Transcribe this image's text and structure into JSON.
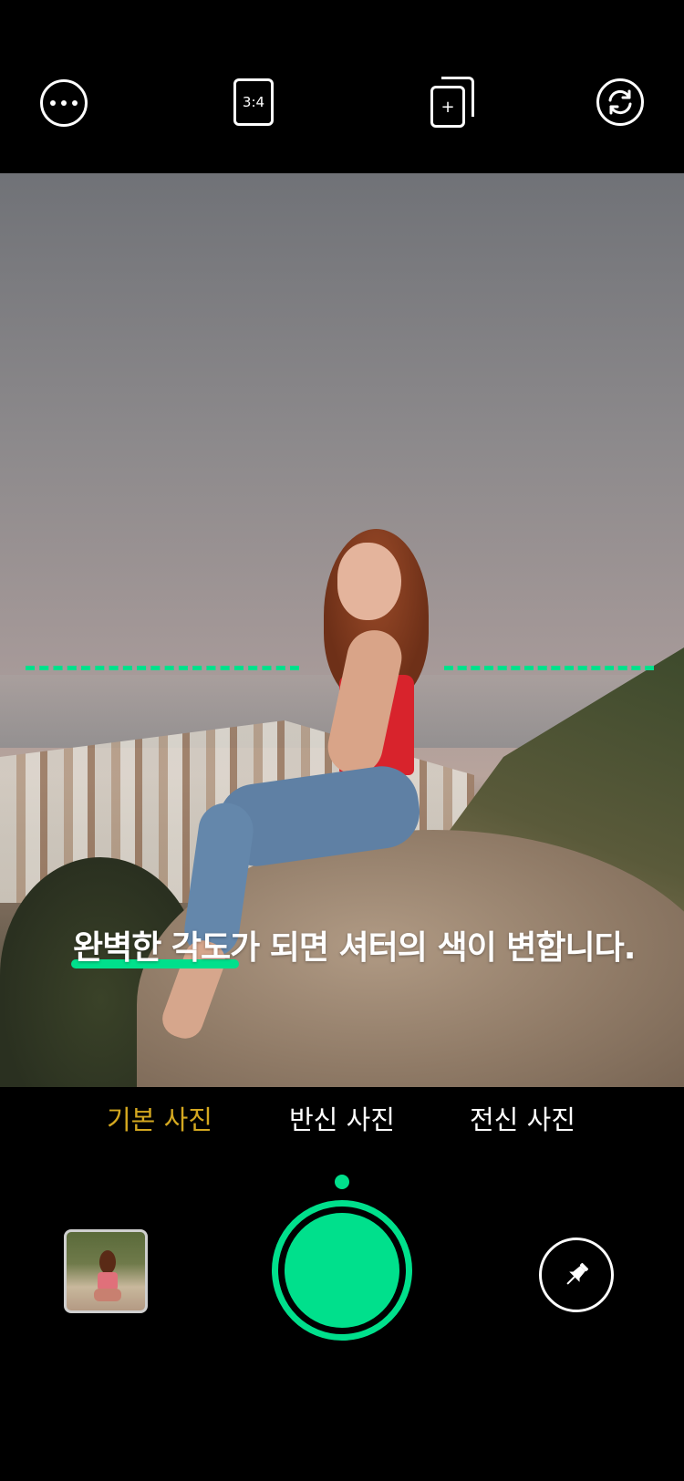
{
  "topbar": {
    "more_icon": "more-horizontal-icon",
    "ratio_label": "3:4",
    "add_icon": "add-frame-icon",
    "add_glyph": "+",
    "flip_icon": "camera-flip-icon"
  },
  "viewfinder": {
    "hint_text": "완벽한 각도가 되면 셔터의 색이 변합니다.",
    "level_line_color": "#00e08c"
  },
  "modes": [
    {
      "label": "기본 사진",
      "active": true
    },
    {
      "label": "반신 사진",
      "active": false
    },
    {
      "label": "전신 사진",
      "active": false
    }
  ],
  "bottombar": {
    "gallery_icon": "gallery-thumbnail",
    "shutter_color": "#00e08c",
    "pin_icon": "pin-icon"
  },
  "colors": {
    "accent": "#00e08c",
    "active_mode": "#d4a820",
    "background": "#000000"
  }
}
